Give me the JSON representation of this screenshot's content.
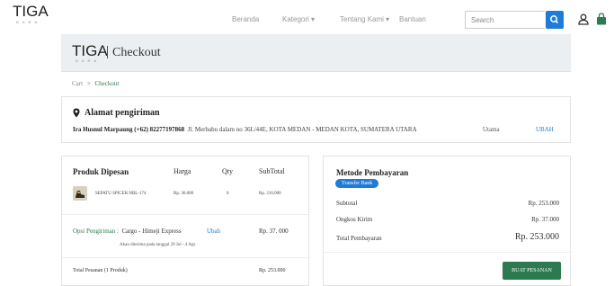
{
  "navbar": {
    "logo_main": "TIGA",
    "logo_sub": "DARA",
    "links": [
      "Beranda",
      "Kategori ▾",
      "Tentang Kami ▾",
      "Bantuan"
    ],
    "search_placeholder": "Search",
    "icons": [
      "search-icon",
      "user-icon",
      "shopping-bag-icon"
    ]
  },
  "header": {
    "logo_main": "TIGA",
    "logo_sub": "DARA",
    "title": "Checkout"
  },
  "breadcrumb": {
    "cart": "Cart",
    "separator": ">",
    "current": "Checkout"
  },
  "address": {
    "title": "Alamat pengiriman",
    "name_phone": "Ira Husnul Marpaung (+62) 82277197868",
    "address": "Jl. Merbabu dalam no 36L/44E, KOTA MEDAN - MEDAN KOTA, SUMATERA UTARA",
    "tag": "Utama",
    "change_label": "UBAH"
  },
  "products": {
    "headers": [
      "Produk Dipesan",
      "Harga",
      "Qty",
      "SubTotal"
    ],
    "items": [
      {
        "name": "SEPATU SPICER.NBL-174",
        "price": "Rp. 36.000",
        "qty": "6",
        "subtotal": "Rp. 216.000"
      }
    ],
    "shipping_label": "Opsi Pengiriman :",
    "shipping_value": "Cargo - Himeji Express",
    "shipping_change": "Ubah",
    "shipping_price": "Rp. 37. 000",
    "shipping_note": "Akan diterima pada tanggal 29 Jul - 4 Agt.",
    "total_label": "Total Pesanan (1 Produk)",
    "total_value": "Rp. 253.000"
  },
  "payment": {
    "title": "Metode Pembayaran",
    "method": "Transfer Bank",
    "subtotal_label": "Subtotal",
    "subtotal_value": "Rp. 253.000",
    "shipping_label": "Ongkos Kirim",
    "shipping_value": "Rp. 37.000",
    "total_label": "Total Pembayaran",
    "total_value": "Rp. 253.000",
    "buy_label": "BUAT PESANAN"
  },
  "colors": {
    "accent_blue": "#1e7bd8",
    "accent_green": "#2c7a4f",
    "header_band": "#eceff1"
  }
}
